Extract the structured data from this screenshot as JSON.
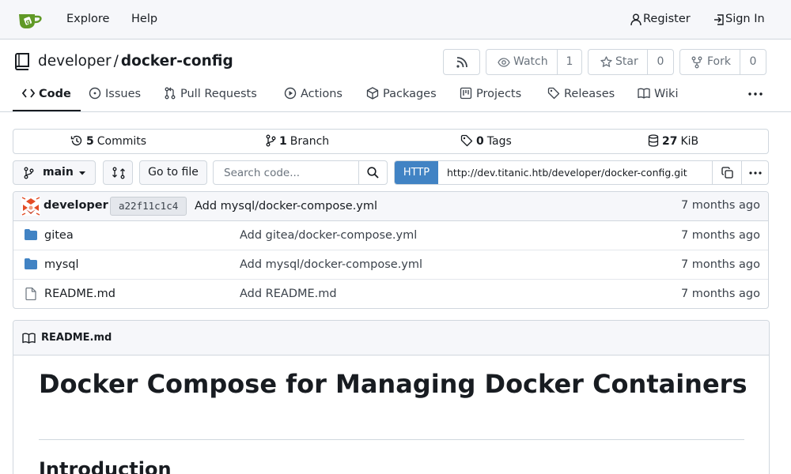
{
  "nav": {
    "explore": "Explore",
    "help": "Help",
    "register": "Register",
    "sign_in": "Sign In"
  },
  "repo": {
    "owner": "developer",
    "separator": "/",
    "name": "docker-config"
  },
  "actions": {
    "watch_label": "Watch",
    "watch_count": "1",
    "star_label": "Star",
    "star_count": "0",
    "fork_label": "Fork",
    "fork_count": "0"
  },
  "tabs": [
    {
      "label": "Code",
      "icon": "code-icon"
    },
    {
      "label": "Issues",
      "icon": "issue-icon"
    },
    {
      "label": "Pull Requests",
      "icon": "pull-request-icon"
    },
    {
      "label": "Actions",
      "icon": "play-icon"
    },
    {
      "label": "Packages",
      "icon": "package-icon"
    },
    {
      "label": "Projects",
      "icon": "project-icon"
    },
    {
      "label": "Releases",
      "icon": "tag-icon"
    },
    {
      "label": "Wiki",
      "icon": "book-icon"
    }
  ],
  "stats": {
    "commits_count": "5",
    "commits_label": "Commits",
    "branches_count": "1",
    "branches_label": "Branch",
    "tags_count": "0",
    "tags_label": "Tags",
    "size_value": "27",
    "size_unit": "KiB"
  },
  "toolbar": {
    "branch": "main",
    "go_to_file": "Go to file",
    "search_placeholder": "Search code...",
    "clone_protocol": "HTTP",
    "clone_url": "http://dev.titanic.htb/developer/docker-config.git"
  },
  "latest_commit": {
    "author": "developer",
    "sha": "a22f11c1c4",
    "message": "Add mysql/docker-compose.yml",
    "time": "7 months ago"
  },
  "files": [
    {
      "name": "gitea",
      "type": "folder",
      "message": "Add gitea/docker-compose.yml",
      "time": "7 months ago"
    },
    {
      "name": "mysql",
      "type": "folder",
      "message": "Add mysql/docker-compose.yml",
      "time": "7 months ago"
    },
    {
      "name": "README.md",
      "type": "file",
      "message": "Add README.md",
      "time": "7 months ago"
    }
  ],
  "readme": {
    "filename": "README.md",
    "title": "Docker Compose for Managing Docker Containers",
    "section": "Introduction"
  },
  "colors": {
    "accent": "#4183c4",
    "logo": "#609926",
    "folder": "#4183c4",
    "text": "#181c21",
    "border": "#d0d7de"
  }
}
